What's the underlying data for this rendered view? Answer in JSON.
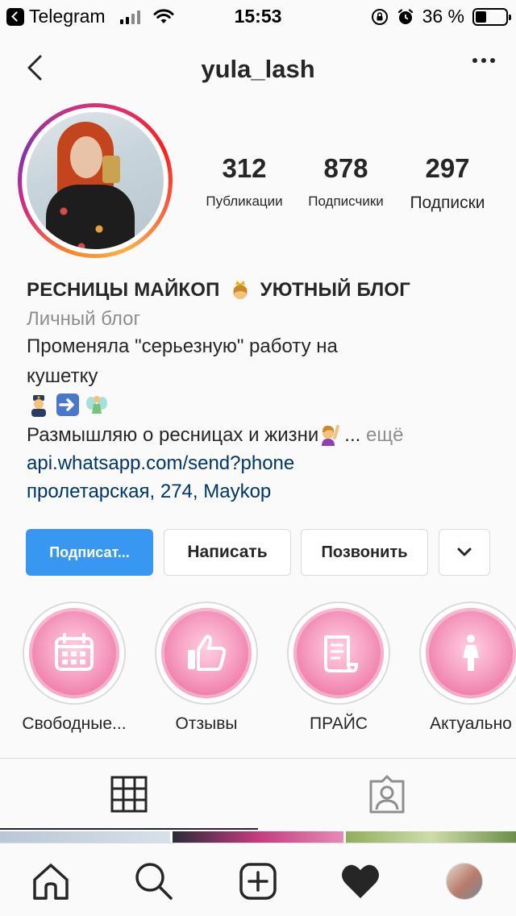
{
  "status_bar": {
    "back_app": "Telegram",
    "time": "15:53",
    "battery_percent": "36 %",
    "battery_level": 0.36
  },
  "nav": {
    "username": "yula_lash"
  },
  "stats": [
    {
      "value": "312",
      "label": "Публикации"
    },
    {
      "value": "878",
      "label": "Подписчики"
    },
    {
      "value": "297",
      "label": "Подписки"
    }
  ],
  "bio": {
    "name_part1": "РЕСНИЦЫ МАЙКОП",
    "name_part2": "УЮТНЫЙ БЛОГ",
    "category": "Личный блог",
    "line1": "Променяла \"серьезную\" работу на",
    "line2": "кушетку",
    "line3": "Размышляю о ресницах и жизни",
    "more_ellipsis": "...",
    "more_word": "ещё",
    "link": "api.whatsapp.com/send?phone",
    "address": "пролетарская, 274, Maykop"
  },
  "buttons": {
    "follow": "Подписат...",
    "message": "Написать",
    "call": "Позвонить"
  },
  "highlights": [
    {
      "label": "Свободные...",
      "icon": "calendar-icon"
    },
    {
      "label": "Отзывы",
      "icon": "thumbs-up-icon"
    },
    {
      "label": "ПРАЙС",
      "icon": "scroll-icon"
    },
    {
      "label": "Актуально",
      "icon": "woman-icon"
    }
  ],
  "colors": {
    "accent": "#3897f0",
    "link": "#003569",
    "muted": "#8e8e8e",
    "highlight_pink": "#ee7aa8"
  }
}
